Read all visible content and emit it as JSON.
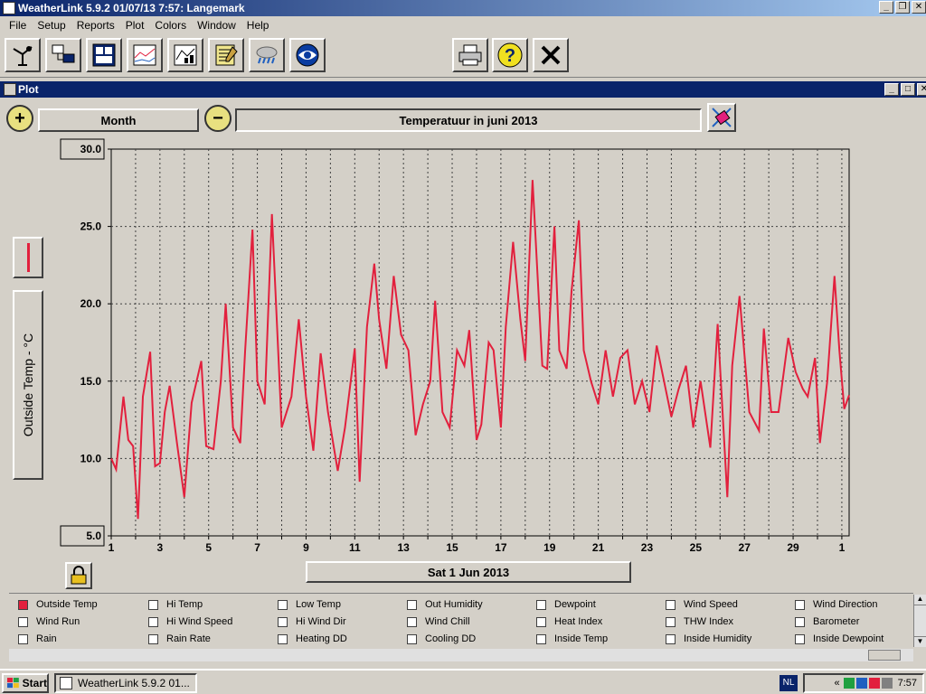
{
  "window": {
    "title": "WeatherLink 5.9.2  01/07/13   7:57: Langemark"
  },
  "menu": [
    "File",
    "Setup",
    "Reports",
    "Plot",
    "Colors",
    "Window",
    "Help"
  ],
  "toolbar": {
    "icons": [
      "station-icon",
      "console-icon",
      "bulletin-icon",
      "strip-chart-icon",
      "plot-icon",
      "notes-icon",
      "weather-icon",
      "noaa-icon",
      "print-icon",
      "help-icon",
      "close-icon"
    ]
  },
  "plot_window": {
    "title": "Plot",
    "period_label": "Month",
    "plot_title": "Temperatuur in juni 2013",
    "date_label": "Sat 1 Jun 2013",
    "y_axis_label": "Outside Temp - °C"
  },
  "chart_data": {
    "type": "line",
    "title": "Temperatuur in juni 2013",
    "ylabel": "Outside Temp - °C",
    "xlabel": "",
    "ylim": [
      5.0,
      30.0
    ],
    "xlim": [
      1,
      31.3
    ],
    "yticks": [
      "30.0",
      "25.0",
      "20.0",
      "15.0",
      "10.0",
      "5.0"
    ],
    "ytick_values": [
      30,
      25,
      20,
      15,
      10,
      5
    ],
    "xticks": [
      "1",
      "3",
      "5",
      "7",
      "9",
      "11",
      "13",
      "15",
      "17",
      "19",
      "21",
      "23",
      "25",
      "27",
      "29",
      "1"
    ],
    "xtick_values": [
      1,
      3,
      5,
      7,
      9,
      11,
      13,
      15,
      17,
      19,
      21,
      23,
      25,
      27,
      29,
      31
    ],
    "grid": true,
    "line_color": "#e2203d",
    "series": [
      {
        "x": [
          1.0,
          1.2,
          1.5,
          1.7,
          1.9,
          2.1,
          2.3,
          2.6,
          2.8,
          3.0,
          3.2,
          3.4,
          3.7,
          4.0,
          4.3,
          4.7,
          4.9,
          5.2,
          5.5,
          5.7,
          6.0,
          6.3,
          6.5,
          6.8,
          7.0,
          7.3,
          7.6,
          8.0,
          8.4,
          8.7,
          9.0,
          9.3,
          9.6,
          9.9,
          10.3,
          10.6,
          11.0,
          11.2,
          11.5,
          11.8,
          12.0,
          12.3,
          12.6,
          12.9,
          13.2,
          13.5,
          13.8,
          14.1,
          14.3,
          14.6,
          14.9,
          15.2,
          15.5,
          15.7,
          16.0,
          16.2,
          16.5,
          16.7,
          17.0,
          17.2,
          17.5,
          17.8,
          18.0,
          18.3,
          18.5,
          18.7,
          18.9,
          19.2,
          19.4,
          19.7,
          19.9,
          20.2,
          20.4,
          20.7,
          21.0,
          21.3,
          21.6,
          21.9,
          22.2,
          22.5,
          22.8,
          23.1,
          23.4,
          23.7,
          24.0,
          24.3,
          24.6,
          24.9,
          25.2,
          25.6,
          25.9,
          26.3,
          26.5,
          26.8,
          27.2,
          27.6,
          27.8,
          28.1,
          28.4,
          28.8,
          29.1,
          29.4,
          29.6,
          29.9,
          30.1,
          30.4,
          30.7,
          30.9,
          31.1,
          31.3
        ],
        "values": [
          10.0,
          9.3,
          14.0,
          11.2,
          10.8,
          6.1,
          14.0,
          16.9,
          9.5,
          9.7,
          13.0,
          14.7,
          11.0,
          7.5,
          13.6,
          16.3,
          10.8,
          10.6,
          15.0,
          20.0,
          12.0,
          11.0,
          17.0,
          24.8,
          15.0,
          13.5,
          25.8,
          12.0,
          14.0,
          19.0,
          14.0,
          10.5,
          16.8,
          13.0,
          9.2,
          12.0,
          17.1,
          8.5,
          18.5,
          22.6,
          19.0,
          15.8,
          21.8,
          18.0,
          17.0,
          11.5,
          13.5,
          15.0,
          20.2,
          13.0,
          12.0,
          17.0,
          16.0,
          18.3,
          11.2,
          12.2,
          17.5,
          17.0,
          12.0,
          18.5,
          24.0,
          19.0,
          16.3,
          28.0,
          22.0,
          16.0,
          15.8,
          25.0,
          17.0,
          15.8,
          20.8,
          25.4,
          17.0,
          15.0,
          13.5,
          17.0,
          14.0,
          16.5,
          17.0,
          13.5,
          15.0,
          13.0,
          17.3,
          15.0,
          12.7,
          14.5,
          16.0,
          12.0,
          15.0,
          10.7,
          18.7,
          7.5,
          16.0,
          20.5,
          13.0,
          11.8,
          18.4,
          13.0,
          13.0,
          17.8,
          15.6,
          14.5,
          14.0,
          16.5,
          11.0,
          15.0,
          21.8,
          17.0,
          13.2,
          14.1
        ]
      }
    ]
  },
  "legend": [
    {
      "label": "Outside Temp",
      "checked": true
    },
    {
      "label": "Hi Temp",
      "checked": false
    },
    {
      "label": "Low Temp",
      "checked": false
    },
    {
      "label": "Out Humidity",
      "checked": false
    },
    {
      "label": "Dewpoint",
      "checked": false
    },
    {
      "label": "Wind Speed",
      "checked": false
    },
    {
      "label": "Wind Direction",
      "checked": false
    },
    {
      "label": "Wind Run",
      "checked": false
    },
    {
      "label": "Hi Wind Speed",
      "checked": false
    },
    {
      "label": "Hi Wind Dir",
      "checked": false
    },
    {
      "label": "Wind Chill",
      "checked": false
    },
    {
      "label": "Heat Index",
      "checked": false
    },
    {
      "label": "THW Index",
      "checked": false
    },
    {
      "label": "Barometer",
      "checked": false
    },
    {
      "label": "Rain",
      "checked": false
    },
    {
      "label": "Rain Rate",
      "checked": false
    },
    {
      "label": "Heating DD",
      "checked": false
    },
    {
      "label": "Cooling DD",
      "checked": false
    },
    {
      "label": "Inside Temp",
      "checked": false
    },
    {
      "label": "Inside Humidity",
      "checked": false
    },
    {
      "label": "Inside Dewpoint",
      "checked": false
    }
  ],
  "taskbar": {
    "start_label": "Start",
    "task_label": "WeatherLink 5.9.2  01...",
    "lang": "NL",
    "tray_chevron": "«",
    "clock": "7:57"
  }
}
